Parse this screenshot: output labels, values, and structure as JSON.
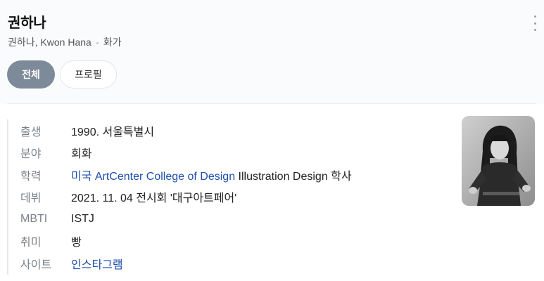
{
  "header": {
    "title": "권하나",
    "name_line": "권하나, Kwon Hana",
    "occupation": "화가"
  },
  "tabs": [
    {
      "label": "전체",
      "active": true
    },
    {
      "label": "프로필",
      "active": false
    }
  ],
  "info": {
    "birth": {
      "label": "출생",
      "value": "1990. 서울특별시"
    },
    "field": {
      "label": "분야",
      "value": "회화"
    },
    "education": {
      "label": "학력",
      "link": "미국 ArtCenter College of Design",
      "rest": " Illustration Design 학사"
    },
    "debut": {
      "label": "데뷔",
      "value": "2021. 11. 04 전시회 '대구아트페어'"
    },
    "mbti": {
      "label": "MBTI",
      "value": "ISTJ"
    },
    "hobby": {
      "label": "취미",
      "value": "빵"
    },
    "site": {
      "label": "사이트",
      "link": "인스타그램"
    }
  },
  "colors": {
    "active_tab": "#7d8a99",
    "link": "#1e4fae",
    "label": "#7a8088"
  },
  "icons": {
    "more": "more-vertical-icon"
  }
}
